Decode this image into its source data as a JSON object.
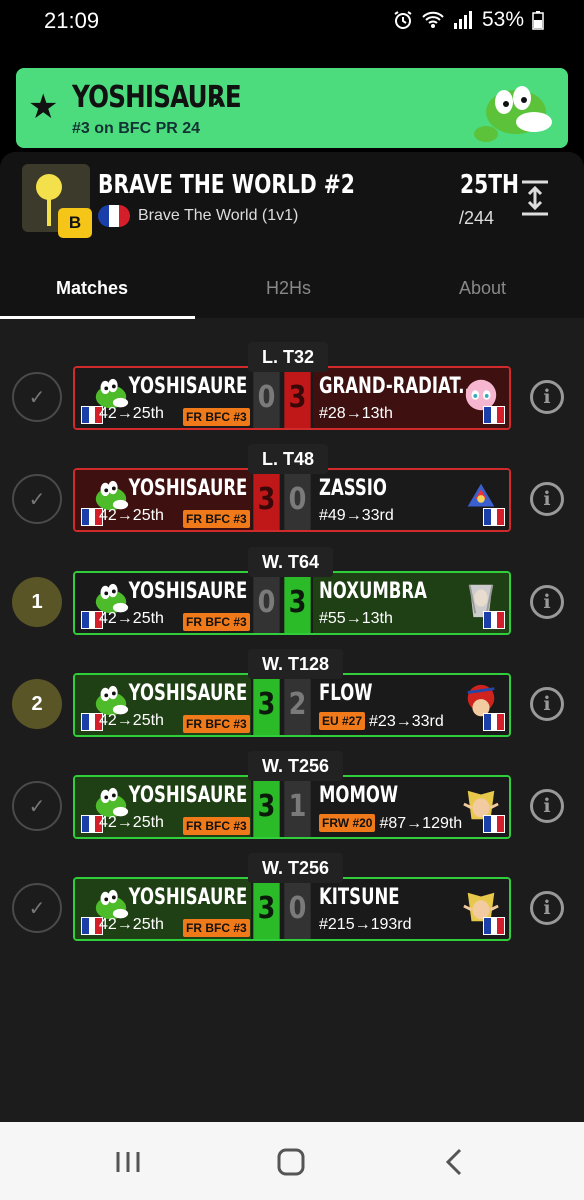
{
  "status_bar": {
    "time": "21:09",
    "battery": "53%"
  },
  "banner": {
    "player_name": "YOSHISAURE",
    "ranking": "#3 on BFC PR 24"
  },
  "tournament": {
    "badge": "B",
    "title": "BRAVE THE WORLD #2",
    "event": "Brave The World (1v1)",
    "placement": "25TH",
    "entrants": "/244"
  },
  "tabs": [
    "Matches",
    "H2Hs",
    "About"
  ],
  "colors": {
    "win": "#2fce3a",
    "lose": "#d02a2a",
    "banner": "#4cdc7e",
    "tag": "#f07a1a"
  },
  "matches": [
    {
      "round": "L. T32",
      "marker": "check",
      "result": "loss",
      "left": {
        "name": "YOSHISAURE",
        "seed": "42→25th",
        "tag": "FR BFC #3",
        "char": "yoshi-icon",
        "score": "0"
      },
      "right": {
        "name": "GRAND-RADIAT...",
        "seed": "#28→13th",
        "tag": "",
        "char": "jigglypuff-icon",
        "score": "3"
      }
    },
    {
      "round": "L. T48",
      "marker": "check",
      "result": "win",
      "left": {
        "name": "YOSHISAURE",
        "seed": "42→25th",
        "tag": "FR BFC #3",
        "char": "yoshi-icon",
        "score": "3"
      },
      "right": {
        "name": "ZASSIO",
        "seed": "#49→33rd",
        "tag": "",
        "char": "falco-icon",
        "score": "0"
      }
    },
    {
      "round": "W. T64",
      "marker": "1",
      "result": "loss",
      "left": {
        "name": "YOSHISAURE",
        "seed": "42→25th",
        "tag": "FR BFC #3",
        "char": "yoshi-icon",
        "score": "0"
      },
      "right": {
        "name": "NOXUMBRA",
        "seed": "#55→13th",
        "tag": "",
        "char": "sephiroth-icon",
        "score": "3"
      }
    },
    {
      "round": "W. T128",
      "marker": "2",
      "result": "win",
      "left": {
        "name": "YOSHISAURE",
        "seed": "42→25th",
        "tag": "FR BFC #3",
        "char": "yoshi-icon",
        "score": "3"
      },
      "right": {
        "name": "FLOW",
        "seed": "#23→33rd",
        "tag": "EU #27",
        "char": "roy-icon",
        "score": "2"
      }
    },
    {
      "round": "W. T256",
      "marker": "check",
      "result": "win",
      "left": {
        "name": "YOSHISAURE",
        "seed": "42→25th",
        "tag": "FR BFC #3",
        "char": "yoshi-icon",
        "score": "3"
      },
      "right": {
        "name": "MOMOW",
        "seed": "#87→129th",
        "tag": "FRW #20",
        "char": "link-icon",
        "score": "1"
      }
    },
    {
      "round": "W. T256",
      "marker": "check",
      "result": "win",
      "left": {
        "name": "YOSHISAURE",
        "seed": "42→25th",
        "tag": "FR BFC #3",
        "char": "yoshi-icon",
        "score": "3"
      },
      "right": {
        "name": "KITSUNE",
        "seed": "#215→193rd",
        "tag": "",
        "char": "link-icon",
        "score": "0"
      }
    }
  ]
}
